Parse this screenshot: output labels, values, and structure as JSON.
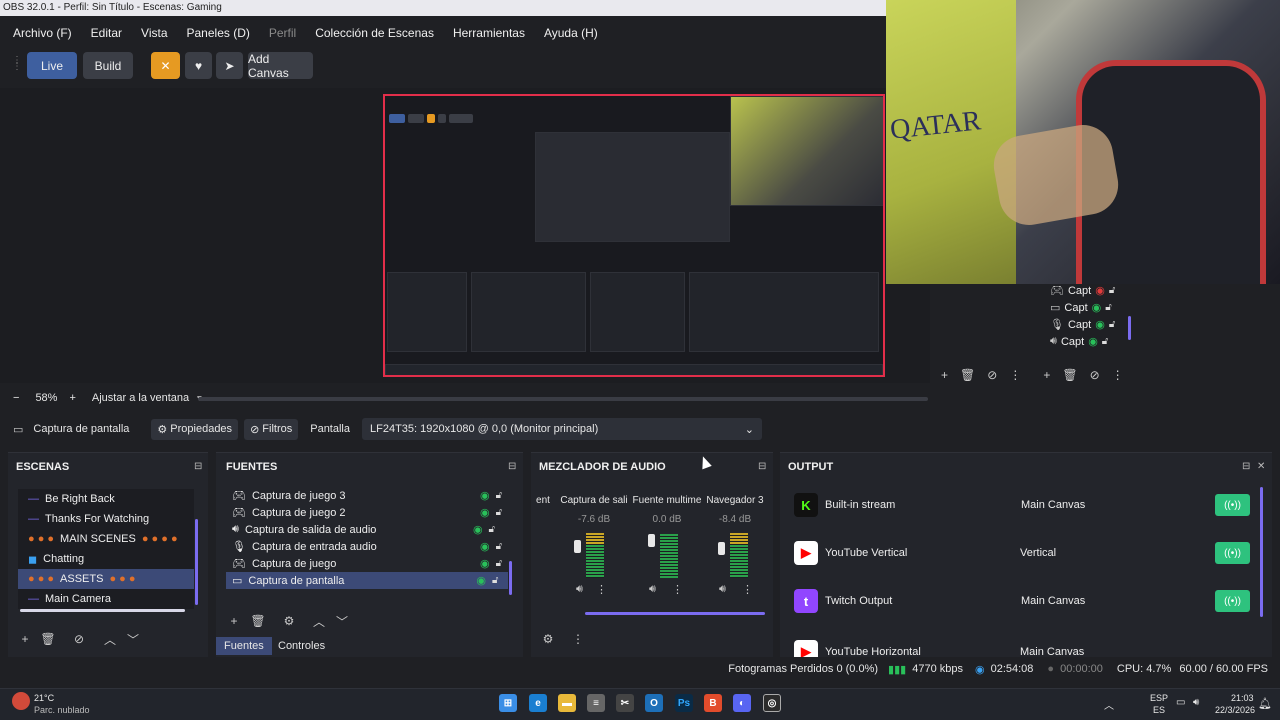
{
  "window": {
    "title": "OBS 32.0.1 - Perfil: Sin Título - Escenas: Gaming"
  },
  "menu": [
    "Archivo (F)",
    "Editar",
    "Vista",
    "Paneles (D)",
    "Perfil",
    "Colección de Escenas",
    "Herramientas",
    "Ayuda (H)"
  ],
  "toolbar": {
    "live": "Live",
    "build": "Build",
    "add_canvas": "Add Canvas"
  },
  "preview": {
    "zoom": "58%",
    "minus": "−",
    "plus": "+",
    "fit": "Ajustar a la ventana"
  },
  "side_sources": [
    "Capt",
    "Capt",
    "Capt",
    "Capt"
  ],
  "properties": {
    "source_name": "Captura de pantalla",
    "props_label": "Propiedades",
    "filters_label": "Filtros",
    "screen_label": "Pantalla",
    "screen_value": "LF24T35: 1920x1080 @ 0,0 (Monitor principal)"
  },
  "scenes": {
    "title": "ESCENAS",
    "items": [
      "Be Right Back",
      "Thanks For Watching",
      "MAIN SCENES",
      "Chatting",
      "ASSETS",
      "Main Camera"
    ]
  },
  "sources": {
    "title": "FUENTES",
    "items": [
      "Captura de juego 3",
      "Captura de juego 2",
      "Captura de salida de audio",
      "Captura de entrada audio",
      "Captura de juego",
      "Captura de pantalla"
    ],
    "tab_sources": "Fuentes",
    "tab_controls": "Controles"
  },
  "mixer": {
    "title": "MEZCLADOR DE AUDIO",
    "channels": [
      {
        "name": "ent",
        "db": ""
      },
      {
        "name": "Captura de sali",
        "db": "-7.6 dB"
      },
      {
        "name": "Fuente multime",
        "db": "0.0 dB"
      },
      {
        "name": "Navegador 3",
        "db": "-8.4 dB"
      }
    ]
  },
  "output": {
    "title": "OUTPUT",
    "rows": [
      {
        "name": "Built-in stream",
        "canvas": "Main Canvas",
        "color": "#53fc18",
        "letter": "K"
      },
      {
        "name": "YouTube Vertical",
        "canvas": "Vertical",
        "color": "#ff0000",
        "letter": "▶"
      },
      {
        "name": "Twitch Output",
        "canvas": "Main Canvas",
        "color": "#9146ff",
        "letter": "t"
      },
      {
        "name": "YouTube Horizontal",
        "canvas": "Main Canvas",
        "color": "#ff0000",
        "letter": "▶"
      }
    ]
  },
  "status": {
    "dropped": "Fotogramas Perdidos 0 (0.0%)",
    "kbps": "4770 kbps",
    "stream_time": "02:54:08",
    "rec_time": "00:00:00",
    "cpu": "CPU: 4.7%",
    "fps": "60.00 / 60.00 FPS"
  },
  "taskbar": {
    "weather_temp": "21°C",
    "weather_desc": "Parc. nublado",
    "lang_top": "ESP",
    "lang_bottom": "ES",
    "time": "21:03",
    "date": "22/3/2026"
  }
}
